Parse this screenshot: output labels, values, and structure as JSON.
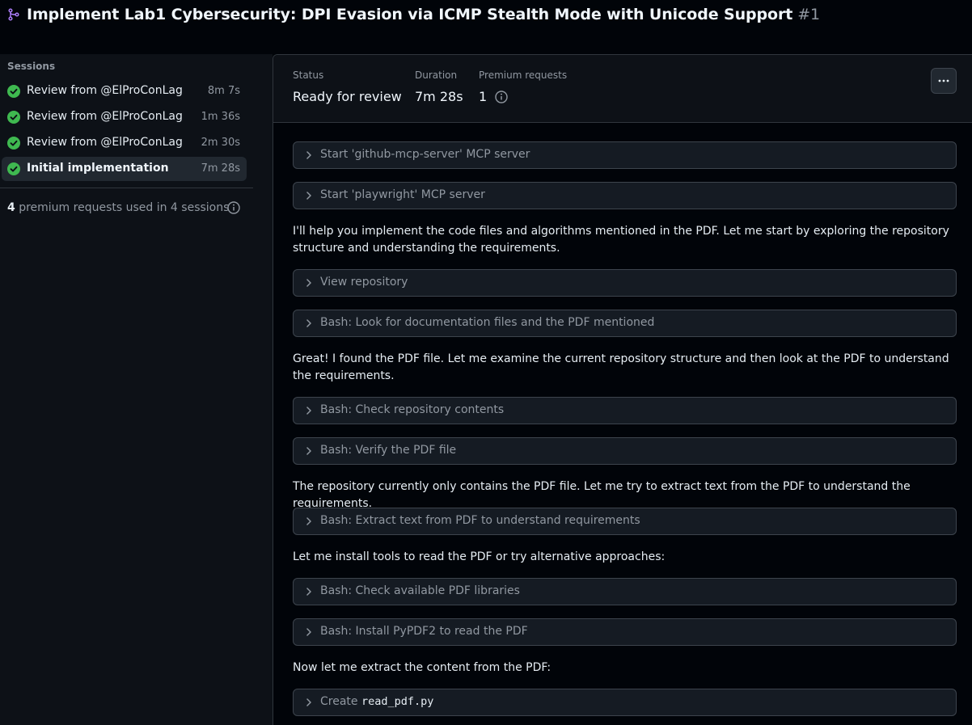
{
  "header": {
    "title": "Implement Lab1 Cybersecurity: DPI Evasion via ICMP Stealth Mode with Unicode Support",
    "number": "#1",
    "icon": "git-pull-request-icon",
    "icon_color": "#ab7df8"
  },
  "sidebar": {
    "sessions_label": "Sessions",
    "sessions": [
      {
        "name": "Review from @ElProConLag",
        "duration": "8m 7s"
      },
      {
        "name": "Review from @ElProConLag",
        "duration": "1m 36s"
      },
      {
        "name": "Review from @ElProConLag",
        "duration": "2m 30s"
      },
      {
        "name": "Initial implementation",
        "duration": "7m 28s"
      }
    ],
    "usage_count": "4",
    "usage_text": " premium requests used in 4 sessions"
  },
  "status": {
    "status_label": "Status",
    "status_value": "Ready for review",
    "duration_label": "Duration",
    "duration_value": "7m 28s",
    "premium_label": "Premium requests",
    "premium_value": "1"
  },
  "log": {
    "step1": "Start 'github-mcp-server' MCP server",
    "step2": "Start 'playwright' MCP server",
    "para1": "I'll help you implement the code files and algorithms mentioned in the PDF. Let me start by exploring the repository structure and understanding the requirements.",
    "step3": "View repository",
    "step4": "Bash: Look for documentation files and the PDF mentioned",
    "para2": "Great! I found the PDF file. Let me examine the current repository structure and then look at the PDF to understand the requirements.",
    "step5": "Bash: Check repository contents",
    "step6": "Bash: Verify the PDF file",
    "para3": "The repository currently only contains the PDF file. Let me try to extract text from the PDF to understand the requirements.",
    "step7": "Bash: Extract text from PDF to understand requirements",
    "para4": "Let me install tools to read the PDF or try alternative approaches:",
    "step8": "Bash: Check available PDF libraries",
    "step9": "Bash: Install PyPDF2 to read the PDF",
    "para5": "Now let me extract the content from the PDF:",
    "step10_prefix": "Create",
    "step10_file": "read_pdf.py"
  },
  "colors": {
    "success": "#3fb950",
    "accent": "#ab7df8"
  }
}
